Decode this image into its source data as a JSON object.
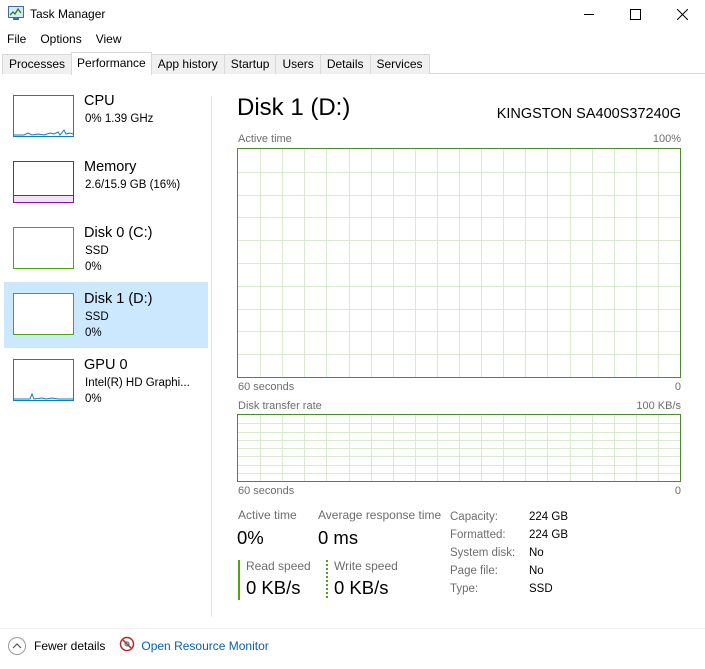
{
  "window": {
    "title": "Task Manager"
  },
  "menu": [
    "File",
    "Options",
    "View"
  ],
  "tabs": [
    "Processes",
    "Performance",
    "App history",
    "Startup",
    "Users",
    "Details",
    "Services"
  ],
  "active_tab": "Performance",
  "devices": [
    {
      "name": "CPU",
      "line1": "0%  1.39 GHz",
      "line2": "",
      "color": "#117dbb"
    },
    {
      "name": "Memory",
      "line1": "2.6/15.9 GB (16%)",
      "line2": "",
      "color": "#8b12ae"
    },
    {
      "name": "Disk 0 (C:)",
      "line1": "SSD",
      "line2": "0%",
      "color": "#4da60c"
    },
    {
      "name": "Disk 1 (D:)",
      "line1": "SSD",
      "line2": "0%",
      "color": "#4da60c",
      "selected": true
    },
    {
      "name": "GPU 0",
      "line1": "Intel(R) HD Graphi...",
      "line2": "0%",
      "color": "#117dbb"
    }
  ],
  "detail": {
    "title": "Disk 1 (D:)",
    "model": "KINGSTON SA400S37240G",
    "graph1": {
      "label": "Active time",
      "max": "100%",
      "x_label": "60 seconds",
      "min": "0"
    },
    "graph2": {
      "label": "Disk transfer rate",
      "max": "100 KB/s",
      "x_label": "60 seconds",
      "min": "0"
    },
    "stats": {
      "active_time_label": "Active time",
      "active_time_value": "0%",
      "avg_response_label": "Average response time",
      "avg_response_value": "0 ms",
      "read_speed_label": "Read speed",
      "read_speed_value": "0 KB/s",
      "write_speed_label": "Write speed",
      "write_speed_value": "0 KB/s"
    },
    "properties": [
      {
        "key": "Capacity:",
        "value": "224 GB"
      },
      {
        "key": "Formatted:",
        "value": "224 GB"
      },
      {
        "key": "System disk:",
        "value": "No"
      },
      {
        "key": "Page file:",
        "value": "No"
      },
      {
        "key": "Type:",
        "value": "SSD"
      }
    ]
  },
  "footer": {
    "fewer_details": "Fewer details",
    "resource_monitor": "Open Resource Monitor"
  },
  "colors": {
    "disk_green": "#4da60c",
    "graph_border": "#4d8a2f",
    "selection": "#cce8ff",
    "link": "#0b5fa5"
  }
}
